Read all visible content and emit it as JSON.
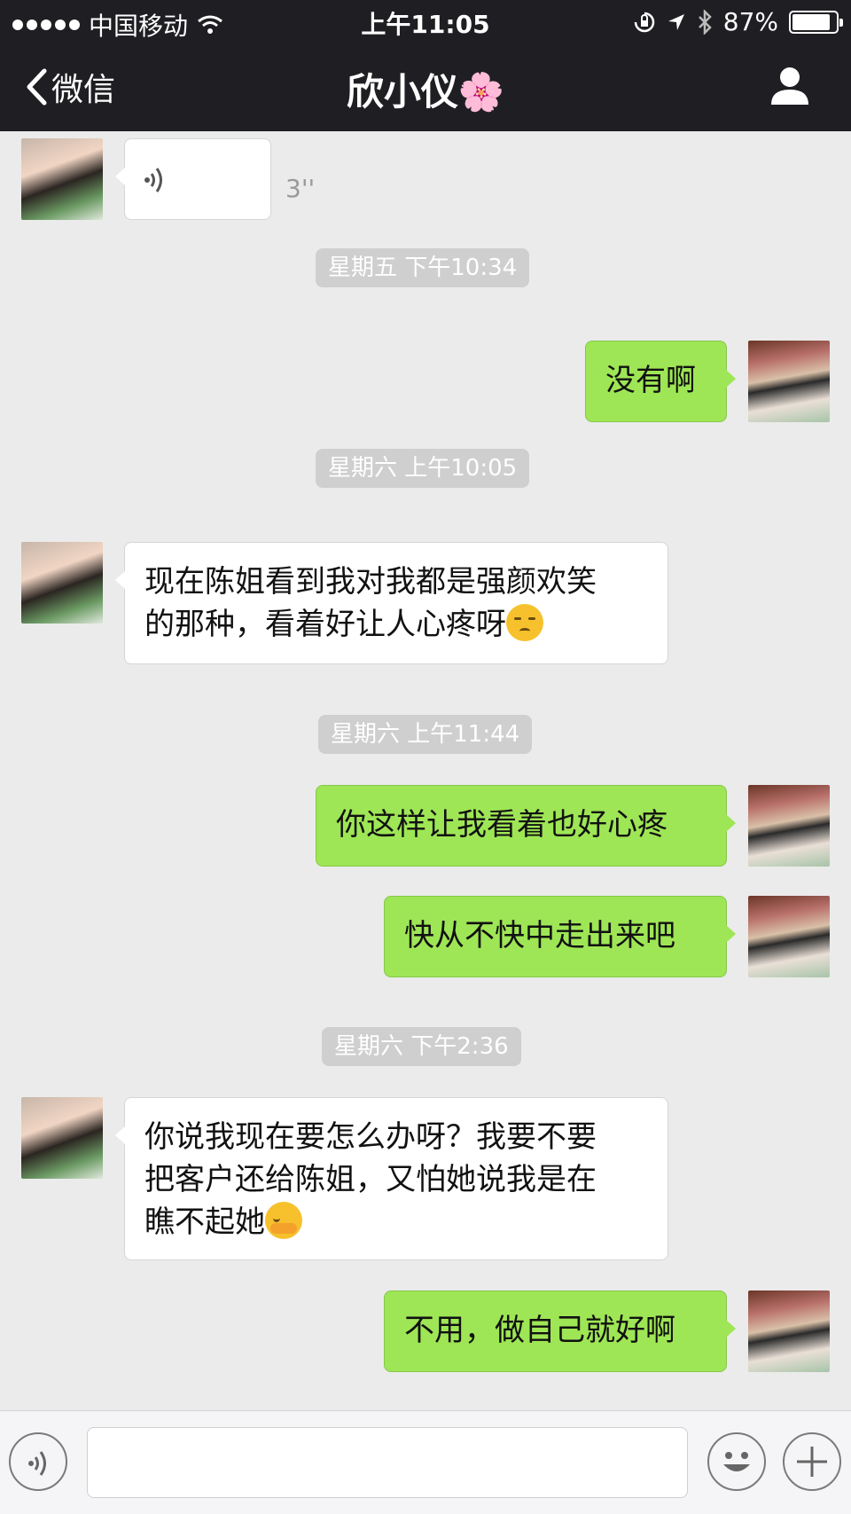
{
  "status_bar": {
    "carrier": "中国移动",
    "time": "上午11:05",
    "battery": "87%",
    "battery_level": 0.87
  },
  "nav": {
    "back_label": "微信",
    "title": "欣小仪🌸"
  },
  "messages": {
    "voice": {
      "duration": "3''"
    },
    "ts1": "星期五 下午10:34",
    "m1": "没有啊",
    "ts2": "星期六 上午10:05",
    "m2_line1": "现在陈姐看到我对我都是强颜欢笑",
    "m2_line2": "的那种，看着好让人心疼呀",
    "ts3": "星期六 上午11:44",
    "m3": "你这样让我看着也好心疼",
    "m4": "快从不快中走出来吧",
    "ts4": "星期六 下午2:36",
    "m5_line1": "你说我现在要怎么办呀？我要不要",
    "m5_line2": "把客户还给陈姐，又怕她说我是在",
    "m5_line3": "瞧不起她",
    "m6": "不用，做自己就好啊"
  },
  "colors": {
    "nav_bg": "#1f1f23",
    "chat_bg": "#ebebeb",
    "outgoing_bubble": "#9ee655",
    "incoming_bubble": "#ffffff",
    "timestamp_pill": "#cfcfcf"
  },
  "icons": [
    "signal-dots-icon",
    "wifi-icon",
    "orientation-lock-icon",
    "location-arrow-icon",
    "bluetooth-icon",
    "battery-icon",
    "chevron-left-icon",
    "person-icon",
    "voice-wave-icon",
    "emoji-smiley-icon",
    "plus-icon",
    "pensive-face-emoji",
    "hugging-face-emoji"
  ]
}
